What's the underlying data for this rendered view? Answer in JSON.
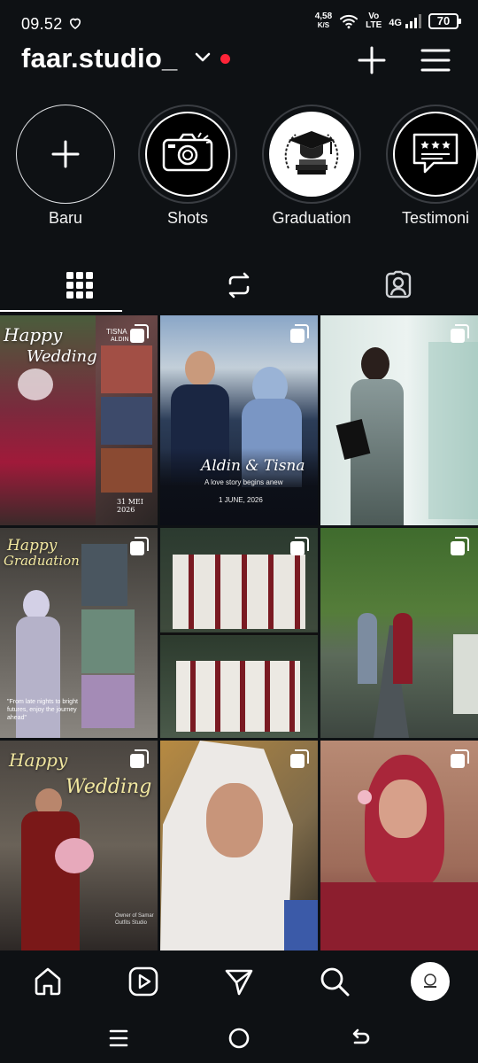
{
  "status_bar": {
    "time": "09.52",
    "net_speed_value": "4,58",
    "net_speed_unit": "K/S",
    "volte_top": "Vo",
    "volte_bottom": "LTE",
    "network": "4G",
    "battery": "70"
  },
  "profile": {
    "username": "faar.studio_",
    "has_notification_dot": true,
    "accent_color": "#ff2438"
  },
  "highlights": [
    {
      "label": "Baru",
      "icon": "plus-icon"
    },
    {
      "label": "Shots",
      "icon": "camera-icon"
    },
    {
      "label": "Graduation",
      "icon": "graduation-cap-icon"
    },
    {
      "label": "Testimoni",
      "icon": "review-speech-icon"
    }
  ],
  "tabs": [
    {
      "name": "posts-grid",
      "icon": "grid-icon",
      "active": true
    },
    {
      "name": "reels",
      "icon": "repost-icon",
      "active": false
    },
    {
      "name": "tagged",
      "icon": "tagged-person-icon",
      "active": false
    }
  ],
  "posts": [
    {
      "caption_top": "Happy",
      "caption_bottom": "Wedding",
      "extra": "TISNA",
      "extra2": "ALDIN",
      "date": "31 MEI 2026",
      "multi": true
    },
    {
      "names": "Aldin & Tisna",
      "tagline": "A love story begins anew",
      "date": "1 JUNE, 2026",
      "multi": true
    },
    {
      "multi": true
    },
    {
      "caption_top": "Happy",
      "caption_bottom": "Graduation",
      "quote": "\"From late nights to bright futures, enjoy the journey ahead\"",
      "multi": true
    },
    {
      "multi": true
    },
    {
      "multi": true
    },
    {
      "caption_top": "Happy",
      "caption_bottom": "Wedding",
      "credit": "Owner of Samar Outfits Studio",
      "multi": true
    },
    {
      "multi": true
    },
    {
      "multi": true
    }
  ],
  "bottom_nav": [
    {
      "name": "home",
      "icon": "home-icon"
    },
    {
      "name": "reels",
      "icon": "reels-icon"
    },
    {
      "name": "messages",
      "icon": "send-icon"
    },
    {
      "name": "search",
      "icon": "search-icon"
    },
    {
      "name": "profile",
      "icon": "avatar"
    }
  ],
  "system_nav": [
    {
      "name": "recents",
      "icon": "recents-icon"
    },
    {
      "name": "home",
      "icon": "home-circle-icon"
    },
    {
      "name": "back",
      "icon": "back-icon"
    }
  ]
}
